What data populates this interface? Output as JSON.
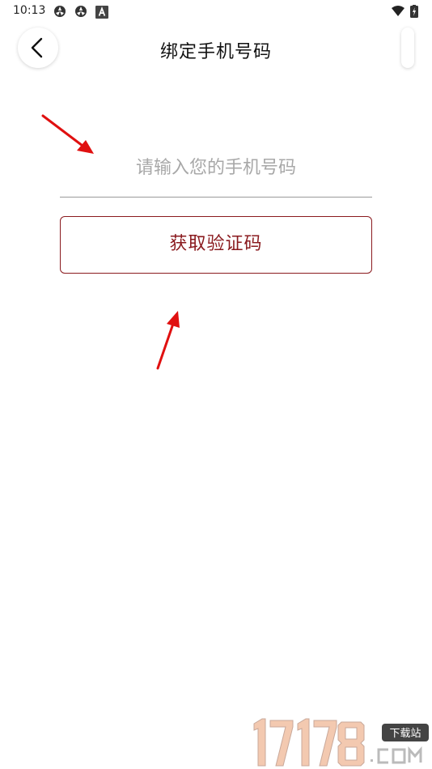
{
  "status_bar": {
    "time": "10:13",
    "icons": [
      "app-notification-icon",
      "app-notification-icon",
      "keyboard-icon",
      "wifi-icon",
      "battery-icon"
    ]
  },
  "header": {
    "title": "绑定手机号码",
    "back_icon": "chevron-left-icon"
  },
  "form": {
    "phone_placeholder": "请输入您的手机号码",
    "phone_value": "",
    "get_code_label": "获取验证码"
  },
  "colors": {
    "accent": "#8a1a1e",
    "placeholder": "#a8a8a8",
    "annotation_arrow": "#e01010"
  },
  "watermark": {
    "number": "17178",
    "domain": "COM",
    "badge": "下载站"
  }
}
